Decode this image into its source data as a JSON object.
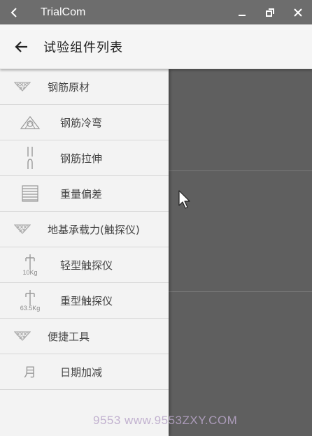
{
  "window": {
    "title": "TrialCom"
  },
  "appbar": {
    "title": "试验组件列表"
  },
  "drawer": {
    "groups": [
      {
        "label": "钢筋原材",
        "icon": "hatch-triangle-icon",
        "items": [
          {
            "label": "钢筋冷弯",
            "icon": "bend-test-icon"
          },
          {
            "label": "钢筋拉伸",
            "icon": "tensile-test-icon"
          },
          {
            "label": "重量偏差",
            "icon": "weight-deviation-icon"
          }
        ]
      },
      {
        "label": "地基承载力(触探仪)",
        "icon": "hatch-triangle-icon",
        "items": [
          {
            "label": "轻型触探仪",
            "icon": "light-penetrometer-icon",
            "badge": "10Kg"
          },
          {
            "label": "重型触探仪",
            "icon": "heavy-penetrometer-icon",
            "badge": "63.5Kg"
          }
        ]
      },
      {
        "label": "便捷工具",
        "icon": "hatch-triangle-icon",
        "items": [
          {
            "label": "日期加减",
            "icon": "calendar-month-icon",
            "badge": "月"
          }
        ]
      }
    ]
  },
  "watermark": {
    "text": "9553 www.9553ZXY.COM"
  }
}
